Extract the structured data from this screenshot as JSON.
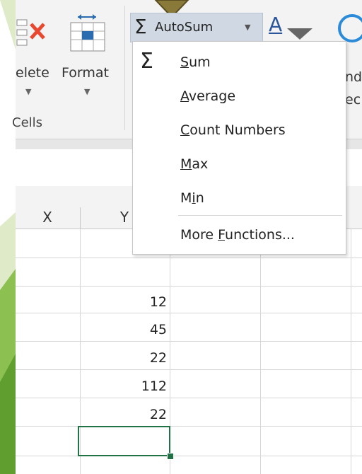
{
  "ribbon": {
    "delete_label": "elete",
    "format_label": "Format",
    "cells_group_label": "Cells",
    "right_partial_1": "nd",
    "right_partial_2": "ec"
  },
  "autosum": {
    "label": "AutoSum"
  },
  "menu": {
    "items": [
      {
        "pre": "",
        "u": "S",
        "post": "um"
      },
      {
        "pre": "",
        "u": "A",
        "post": "verage"
      },
      {
        "pre": "",
        "u": "C",
        "post": "ount Numbers"
      },
      {
        "pre": "",
        "u": "M",
        "post": "ax"
      },
      {
        "pre": "M",
        "u": "i",
        "post": "n"
      },
      {
        "pre": "More ",
        "u": "F",
        "post": "unctions..."
      }
    ]
  },
  "columns": [
    "X",
    "Y"
  ],
  "cells": [
    "12",
    "45",
    "22",
    "112",
    "22"
  ],
  "colors": {
    "accent_green": "#217346",
    "slide_green": "#6aa83a",
    "slide_light": "#dfeac8"
  }
}
